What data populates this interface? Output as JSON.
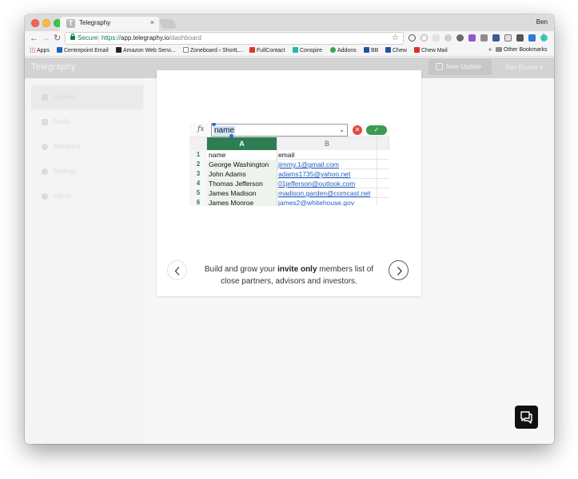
{
  "browser": {
    "tab_title": "Telegraphy",
    "tab_close": "×",
    "profile_name": "Ben",
    "secure_label": "Secure",
    "url_scheme": "https://",
    "url_host": "app.telegraphy.io",
    "url_path": "/dashboard",
    "bookmarks": [
      {
        "label": "Apps"
      },
      {
        "label": "Centrepoint Email"
      },
      {
        "label": "Amazon Web Servi..."
      },
      {
        "label": "Zoneboard ‹ ShortL..."
      },
      {
        "label": "FullContact"
      },
      {
        "label": "Conspire"
      },
      {
        "label": "Addons"
      },
      {
        "label": "BB"
      },
      {
        "label": "Chew"
      },
      {
        "label": "Chew Mail"
      }
    ],
    "bookmarks_overflow": "»",
    "other_bookmarks": "Other Bookmarks"
  },
  "app": {
    "brand": "Telegraphy",
    "new_update_label": "New Update",
    "user_menu": "Ben Bowler ▾",
    "sidebar": [
      {
        "label": "Updates",
        "active": true
      },
      {
        "label": "Drafts"
      },
      {
        "label": "Members"
      },
      {
        "label": "Settings"
      },
      {
        "label": "Admin"
      }
    ]
  },
  "modal": {
    "text_before": "Build and grow your ",
    "text_bold": "invite only",
    "text_after": " members list of close partners, advisors and investors."
  },
  "sheet": {
    "fx_label": "fx",
    "formula_value": "name",
    "columns": [
      "A",
      "B"
    ],
    "rows": [
      {
        "num": "1",
        "a": "name",
        "b": "email"
      },
      {
        "num": "2",
        "a": "George Washington",
        "b": "jimmy.1@gmail.com"
      },
      {
        "num": "3",
        "a": "John Adams",
        "b": "adams1735@yahoo.net"
      },
      {
        "num": "4",
        "a": "Thomas Jefferson",
        "b": "01jefferson@outlook.com"
      },
      {
        "num": "5",
        "a": "James Madison",
        "b": "madison.garden@comcast.net"
      },
      {
        "num": "6",
        "a": "James Monroe",
        "b": "james2@whitehouse.gov"
      }
    ]
  },
  "colors": {
    "sheet_accent": "#2e7d53",
    "link": "#1f5fc4",
    "secure_green": "#0b8043"
  }
}
